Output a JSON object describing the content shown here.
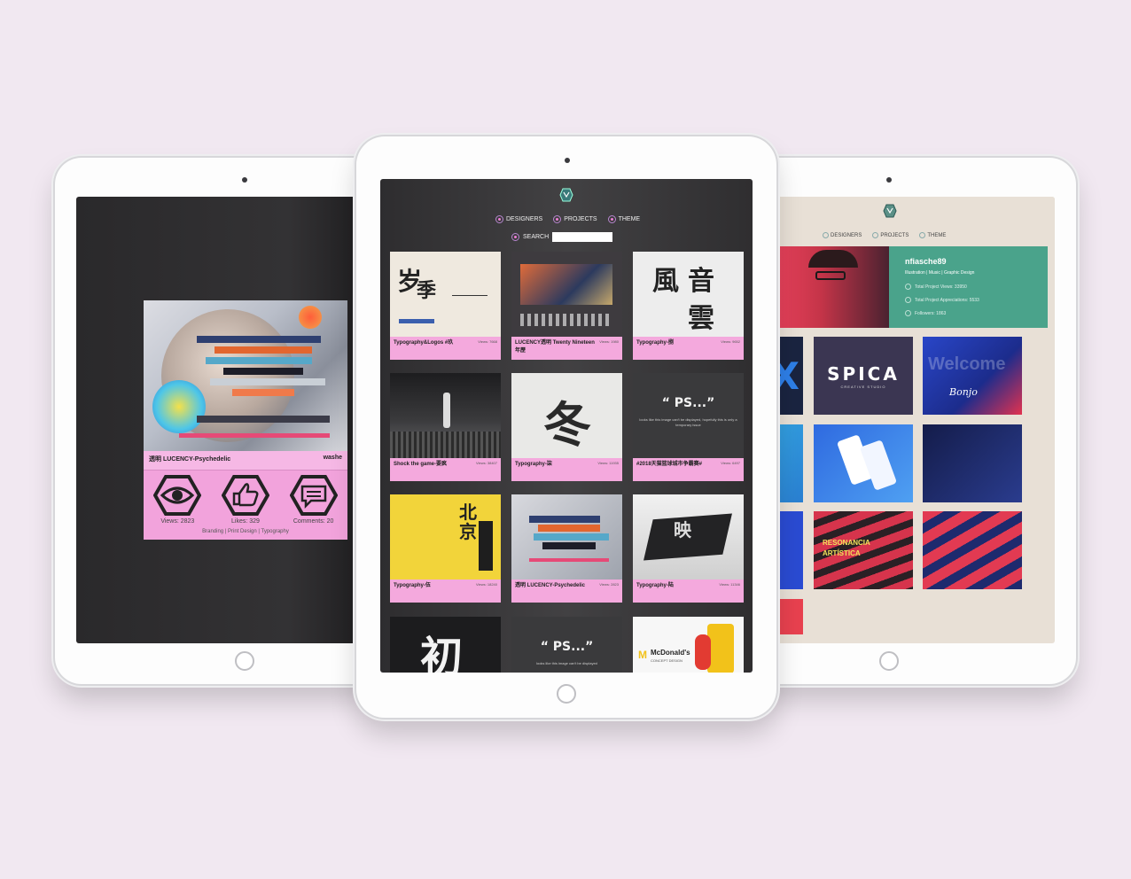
{
  "left_screen": {
    "title": "透明 LUCENCY-Psychedelic",
    "author": "washe",
    "stats": {
      "views": "Views: 2823",
      "likes": "Likes: 329",
      "comments": "Comments: 20"
    },
    "tags": "Branding | Print Design | Typography"
  },
  "center_screen": {
    "nav": {
      "designers": "DESIGNERS",
      "projects": "PROJECTS",
      "theme": "THEME",
      "search": "SEARCH"
    },
    "search": {
      "value": "",
      "placeholder": ""
    },
    "cards": [
      {
        "title": "Typography&Logos #玖",
        "views": "Views: 7668"
      },
      {
        "title": "LUCENCY透明 Twenty Nineteen 年歷",
        "views": "Views: 1980"
      },
      {
        "title": "Typography-捌",
        "views": "Views: 9652"
      },
      {
        "title": "Shock the game-要疯",
        "views": "Views: 38407"
      },
      {
        "title": "Typography-柒",
        "views": "Views: 11935"
      },
      {
        "title": "#2018天猫篮球城市争霸赛#",
        "views": "Views: 6497"
      },
      {
        "title": "Typography-伍",
        "views": "Views: 18240"
      },
      {
        "title": "透明 LUCENCY-Psychedelic",
        "views": "Views: 2823"
      },
      {
        "title": "Typography-陆",
        "views": "Views: 11346"
      }
    ],
    "oops_text": "“ PS...”",
    "oops_sub": "looks like this image can't be displayed, hopefully this is only a temporary issue",
    "oops_sub_short": "looks like this image can't be displayed",
    "glyphs": [
      "岁",
      "季",
      "風",
      "音",
      "雲",
      "冬",
      "北",
      "京",
      "映",
      "初"
    ],
    "mcdonalds": "McDonald's",
    "mcdonalds_sub": "CONCEPT DESIGN"
  },
  "right_screen": {
    "nav": {
      "designers": "DESIGNERS",
      "projects": "PROJECTS",
      "theme": "THEME"
    },
    "profile": {
      "name": "nfiasche89",
      "roles": "Illustration | Music | Graphic Design",
      "views": "Total Project Views: 33950",
      "appreciations": "Total Project Appreciations: 5533",
      "followers": "Followers: 1863"
    },
    "spica": "SPICA",
    "spica_sub": "CREATIVE STUDIO",
    "welcome": "Welcome",
    "bonjo": "Bonjo",
    "resonancia": "RESONANCIA ARTÍSTICA",
    "ux": "UX"
  },
  "colors": {
    "accent_pink": "#f4a9dd",
    "background": "#f1e8f1",
    "teal": "#4aa38b"
  }
}
